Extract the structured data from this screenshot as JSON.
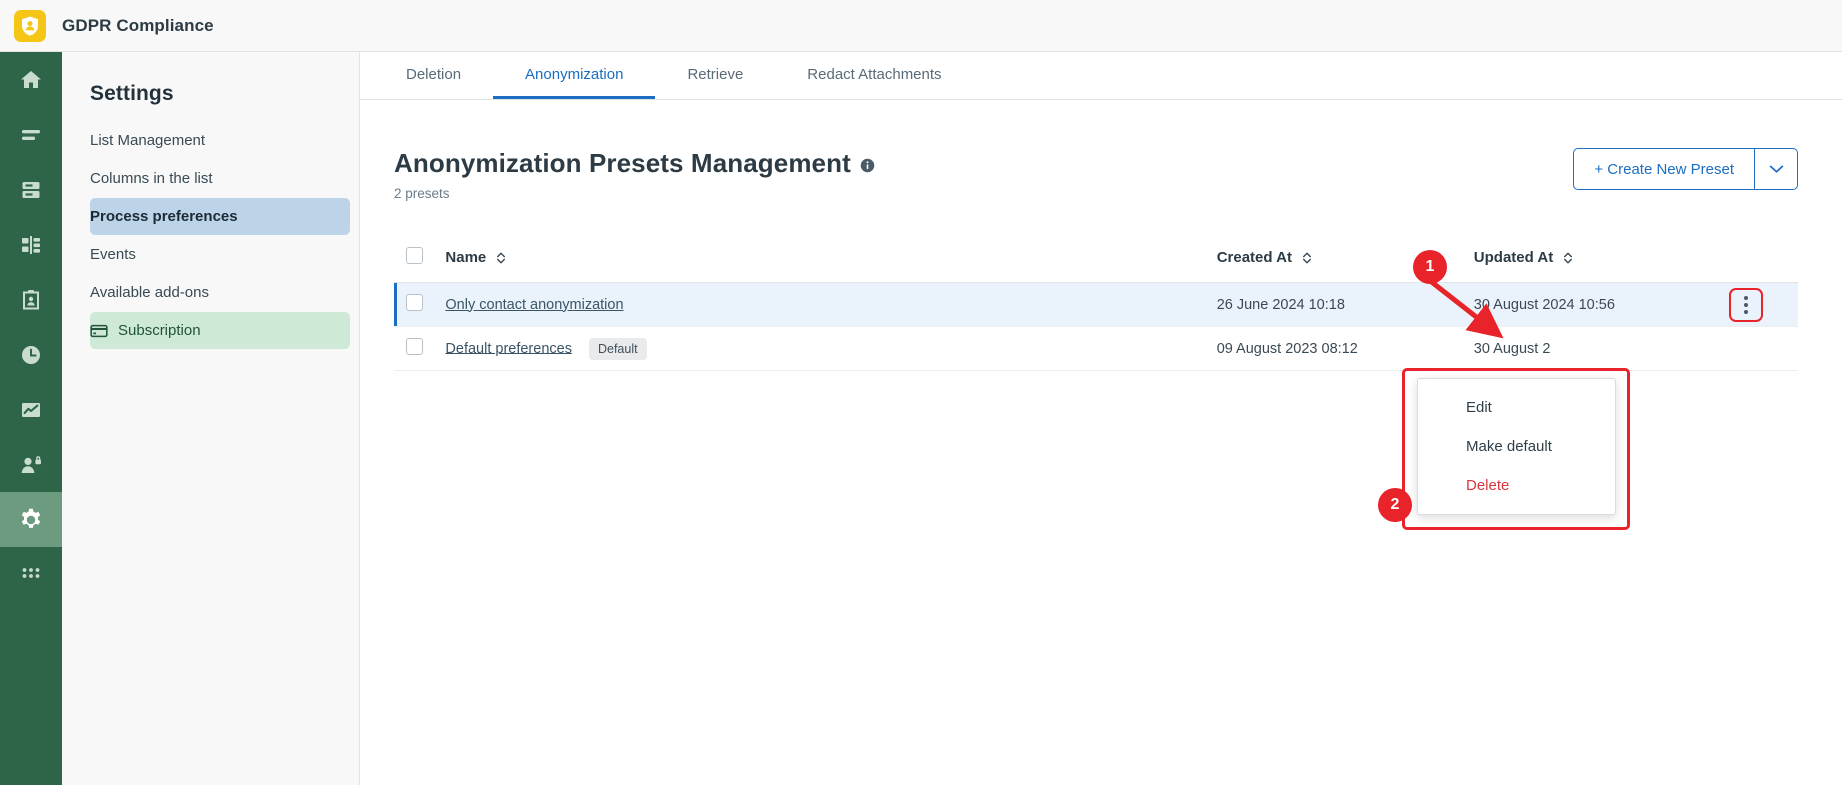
{
  "app": {
    "title": "GDPR Compliance",
    "logo_icon": "shield-user-icon"
  },
  "rail": {
    "items": [
      {
        "icon": "home-icon",
        "name": "home",
        "active": false
      },
      {
        "icon": "list-icon",
        "name": "lists",
        "active": false
      },
      {
        "icon": "database-icon",
        "name": "database",
        "active": false
      },
      {
        "icon": "flow-icon",
        "name": "processes",
        "active": false
      },
      {
        "icon": "clipboard-user-icon",
        "name": "requests",
        "active": false
      },
      {
        "icon": "clock-icon",
        "name": "history",
        "active": false
      },
      {
        "icon": "chart-icon",
        "name": "reports",
        "active": false
      },
      {
        "icon": "user-lock-icon",
        "name": "privacy",
        "active": false
      },
      {
        "icon": "gear-icon",
        "name": "settings",
        "active": true
      },
      {
        "icon": "grid-apps-icon",
        "name": "apps",
        "active": false
      }
    ]
  },
  "settings": {
    "heading": "Settings",
    "items": [
      {
        "label": "List Management",
        "state": "normal"
      },
      {
        "label": "Columns in the list",
        "state": "normal"
      },
      {
        "label": "Process preferences",
        "state": "selected"
      },
      {
        "label": "Events",
        "state": "normal"
      },
      {
        "label": "Available add-ons",
        "state": "normal"
      },
      {
        "label": "Subscription",
        "state": "green",
        "icon": "credit-card-icon"
      }
    ]
  },
  "tabs": [
    {
      "label": "Deletion",
      "active": false
    },
    {
      "label": "Anonymization",
      "active": true
    },
    {
      "label": "Retrieve",
      "active": false
    },
    {
      "label": "Redact Attachments",
      "active": false
    }
  ],
  "page": {
    "title": "Anonymization Presets Management",
    "info_icon": "info-circle-icon",
    "subtitle": "2 presets",
    "create_button": "+ Create New Preset",
    "create_caret_icon": "chevron-down-icon"
  },
  "table": {
    "columns": [
      {
        "key": "check",
        "label": ""
      },
      {
        "key": "name",
        "label": "Name",
        "sortable": true
      },
      {
        "key": "created",
        "label": "Created At",
        "sortable": true
      },
      {
        "key": "updated",
        "label": "Updated At",
        "sortable": true
      },
      {
        "key": "menu",
        "label": ""
      }
    ],
    "rows": [
      {
        "name": "Only contact anonymization",
        "badge": "",
        "created": "26 June 2024 10:18",
        "updated": "30 August 2024 10:56",
        "selected": true
      },
      {
        "name": "Default preferences",
        "badge": "Default",
        "created": "09 August 2023 08:12",
        "updated": "30 August 2",
        "selected": false
      }
    ]
  },
  "context_menu": {
    "items": [
      {
        "label": "Edit",
        "danger": false
      },
      {
        "label": "Make default",
        "danger": false
      },
      {
        "label": "Delete",
        "danger": true
      }
    ]
  },
  "annotations": [
    {
      "label": "1"
    },
    {
      "label": "2"
    }
  ],
  "colors": {
    "rail_green": "#2e6447",
    "accent_blue": "#1b6ec2",
    "annotation_red": "#e8232a",
    "logo_yellow": "#f5c518",
    "danger_red": "#d9363e"
  }
}
